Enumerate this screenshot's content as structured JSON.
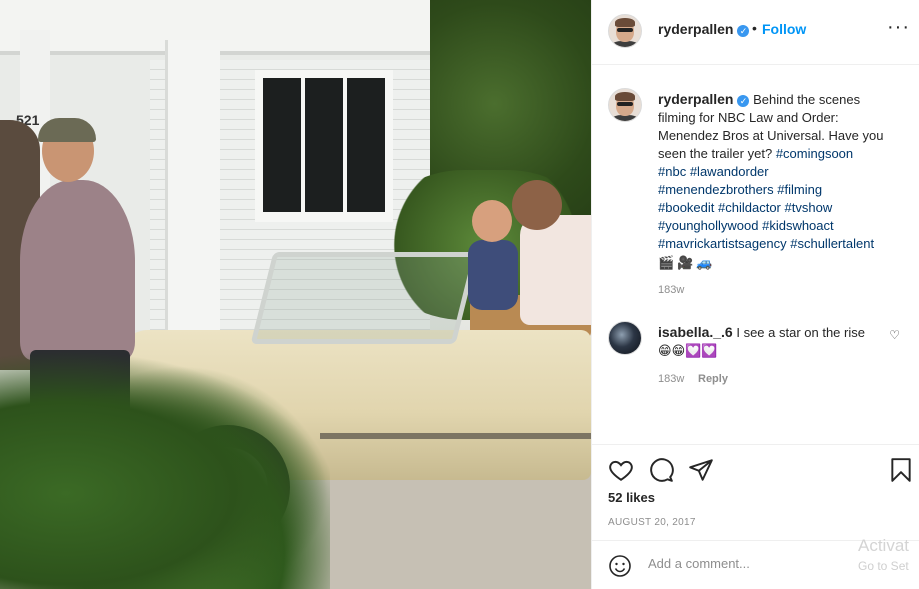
{
  "post": {
    "username": "ryderpallen",
    "separator": "•",
    "follow_label": "Follow",
    "more_label": "···",
    "caption": {
      "lines": [
        "Behind the scenes",
        "filming for NBC Law and Order:",
        "Menendez Bros at Universal. Have you",
        "seen the trailer yet?"
      ],
      "hashtags_line1": "#comingsoon",
      "hashtags": [
        [
          "#nbc",
          "#lawandorder"
        ],
        [
          "#menendezbrothers",
          "#filming"
        ],
        [
          "#bookedit",
          "#childactor",
          "#tvshow"
        ],
        [
          "#younghollywood",
          "#kidswhoact"
        ],
        [
          "#mavrickartistsagency",
          "#schullertalent"
        ]
      ],
      "emoji": [
        "🎬",
        "🎥",
        "🚙"
      ],
      "time": "183w"
    },
    "photo": {
      "house_number": "521"
    }
  },
  "comments": [
    {
      "username": "isabella._.6",
      "text": "I see a star on the rise",
      "emoji": [
        "😁",
        "😁",
        "💟",
        "💟"
      ],
      "time": "183w",
      "reply_label": "Reply"
    }
  ],
  "actions": {
    "likes": "52 likes",
    "date": "AUGUST 20, 2017"
  },
  "add_comment": {
    "placeholder": "Add a comment..."
  },
  "watermark": {
    "line1": "Activat",
    "line2": "Go to Set"
  }
}
